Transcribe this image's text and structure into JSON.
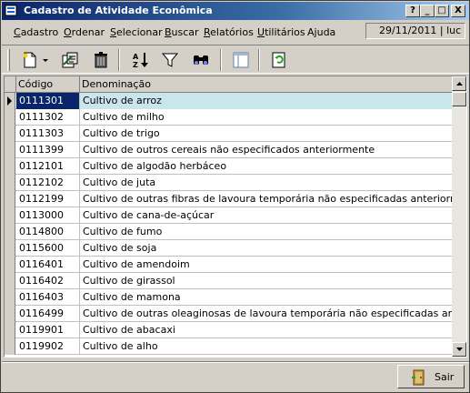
{
  "window": {
    "title": "Cadastro de Atividade Econômica",
    "help_label": "?",
    "minimize_label": "_",
    "maximize_label": "□",
    "close_label": "X"
  },
  "menu": {
    "items": [
      {
        "u": "C",
        "rest": "adastro"
      },
      {
        "u": "O",
        "rest": "rdenar"
      },
      {
        "u": "S",
        "rest": "elecionar"
      },
      {
        "u": "B",
        "rest": "uscar"
      },
      {
        "u": "R",
        "rest": "elatórios"
      },
      {
        "u": "U",
        "rest": "tilitários"
      },
      {
        "pre": "A",
        "u": "j",
        "rest": "uda"
      }
    ],
    "status": "29/11/2011 | luc"
  },
  "toolbar": {
    "icons": [
      "new-icon",
      "dropdown-arrow-icon",
      "edit-icon",
      "delete-icon",
      "sort-az-icon",
      "filter-icon",
      "find-icon",
      "columns-icon",
      "refresh-icon"
    ]
  },
  "grid": {
    "columns": [
      "Código",
      "Denominação"
    ],
    "rows": [
      [
        "0111301",
        "Cultivo de arroz"
      ],
      [
        "0111302",
        "Cultivo de milho"
      ],
      [
        "0111303",
        "Cultivo de trigo"
      ],
      [
        "0111399",
        "Cultivo de outros cereais não especificados anteriormente"
      ],
      [
        "0112101",
        "Cultivo de algodão herbáceo"
      ],
      [
        "0112102",
        "Cultivo de juta"
      ],
      [
        "0112199",
        "Cultivo de outras fibras de lavoura temporária não especificadas anteriormente"
      ],
      [
        "0113000",
        "Cultivo de cana-de-açúcar"
      ],
      [
        "0114800",
        "Cultivo de fumo"
      ],
      [
        "0115600",
        "Cultivo de soja"
      ],
      [
        "0116401",
        "Cultivo de amendoim"
      ],
      [
        "0116402",
        "Cultivo de girassol"
      ],
      [
        "0116403",
        "Cultivo de mamona"
      ],
      [
        "0116499",
        "Cultivo de outras oleaginosas de lavoura temporária não especificadas anteriormente"
      ],
      [
        "0119901",
        "Cultivo de abacaxi"
      ],
      [
        "0119902",
        "Cultivo de alho"
      ]
    ],
    "selected_index": 0
  },
  "footer": {
    "exit_label": "Sair"
  },
  "colors": {
    "title_start": "#0a246a",
    "title_end": "#a6caf0",
    "selection": "#0a246a",
    "row_highlight": "#c8e6ec"
  }
}
